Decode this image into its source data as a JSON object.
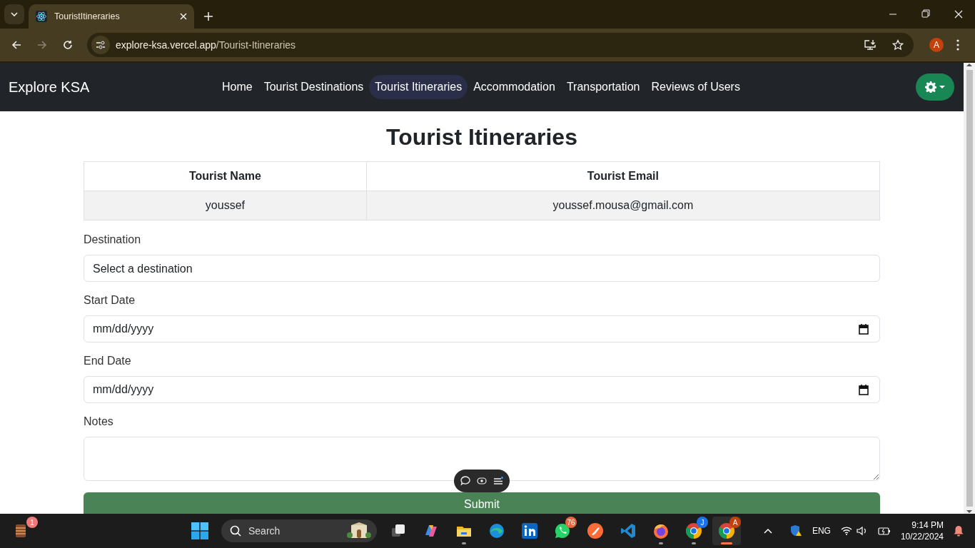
{
  "browser": {
    "tab_title": "TouristItineraries",
    "url_host": "explore-ksa.vercel.app",
    "url_path": "/Tourist-Itineraries",
    "profile_initial": "A"
  },
  "navbar": {
    "brand": "Explore KSA",
    "links": [
      {
        "label": "Home",
        "selected": false
      },
      {
        "label": "Tourist Destinations",
        "selected": false
      },
      {
        "label": "Tourist Itineraries",
        "selected": true
      },
      {
        "label": "Accommodation",
        "selected": false
      },
      {
        "label": "Transportation",
        "selected": false
      },
      {
        "label": "Reviews of Users",
        "selected": false
      }
    ]
  },
  "page": {
    "title": "Tourist Itineraries",
    "table": {
      "columns": [
        "Tourist Name",
        "Tourist Email"
      ],
      "rows": [
        [
          "youssef",
          "youssef.mousa@gmail.com"
        ]
      ]
    },
    "fields": [
      {
        "kind": "select",
        "label": "Destination",
        "value": "Select a destination"
      },
      {
        "kind": "date",
        "label": "Start Date",
        "placeholder": "mm/dd/yyyy"
      },
      {
        "kind": "date",
        "label": "End Date",
        "placeholder": "mm/dd/yyyy"
      },
      {
        "kind": "textarea",
        "label": "Notes"
      }
    ],
    "submit": "Submit"
  },
  "taskbar": {
    "widget_badge": "1",
    "search_placeholder": "Search",
    "apps": [
      {
        "kind": "taskview",
        "running": false,
        "selected": false
      },
      {
        "kind": "copilot",
        "running": false,
        "selected": false
      },
      {
        "kind": "explorer",
        "running": true,
        "selected": false
      },
      {
        "kind": "edge",
        "running": false,
        "selected": false
      },
      {
        "kind": "linkedin",
        "running": false,
        "selected": false
      },
      {
        "kind": "whatsapp",
        "badge": "76",
        "running": false,
        "selected": false
      },
      {
        "kind": "postman",
        "running": false,
        "selected": false
      },
      {
        "kind": "vscode",
        "running": false,
        "selected": false
      },
      {
        "kind": "firefox",
        "running": true,
        "selected": false
      },
      {
        "kind": "chrome",
        "badge": "J",
        "running": true,
        "selected": false
      },
      {
        "kind": "chrome",
        "badge": "A",
        "running": true,
        "selected": true
      }
    ],
    "language": "ENG",
    "time": "9:14 PM",
    "date": "10/22/2024"
  }
}
